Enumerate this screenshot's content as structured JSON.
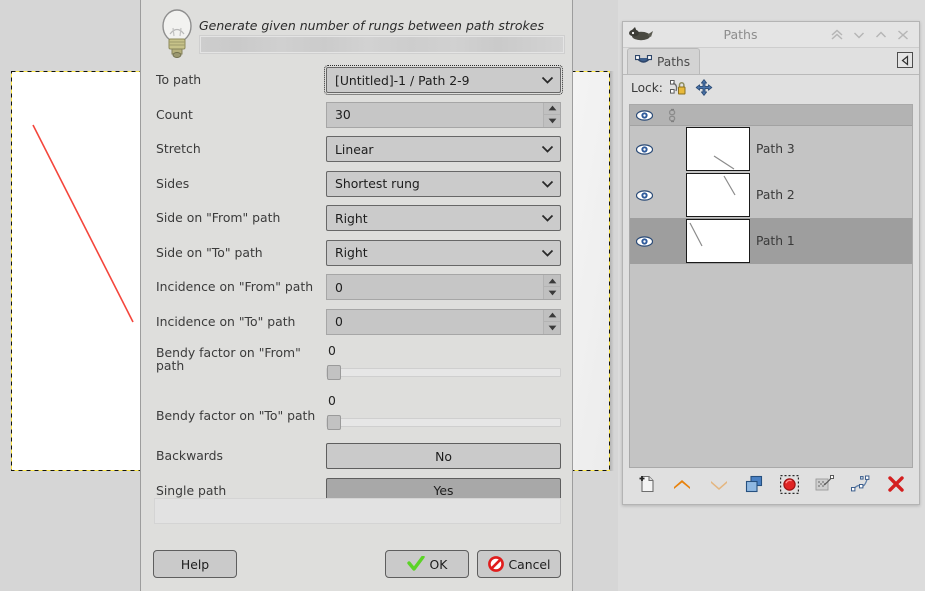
{
  "canvas": {
    "name": "image-canvas",
    "line_color": "#f4463c",
    "border_style": "yellow-black-dashed"
  },
  "dialog": {
    "description": "Generate given number of rungs between path strokes",
    "bulb_icon": "light-bulb-icon",
    "progress_label": "",
    "fields": [
      {
        "label": "To path",
        "type": "combo",
        "value": "[Untitled]-1 / Path 2-9",
        "focused": true
      },
      {
        "label": "Count",
        "type": "spin",
        "value": "30"
      },
      {
        "label": "Stretch",
        "type": "combo",
        "value": "Linear",
        "focused": false
      },
      {
        "label": "Sides",
        "type": "combo",
        "value": "Shortest rung",
        "focused": false
      },
      {
        "label": "Side on \"From\" path",
        "type": "combo",
        "value": "Right",
        "focused": false
      },
      {
        "label": "Side on \"To\" path",
        "type": "combo",
        "value": "Right",
        "focused": false
      },
      {
        "label": "Incidence on \"From\" path",
        "type": "spin",
        "value": "0"
      },
      {
        "label": "Incidence on \"To\" path",
        "type": "spin",
        "value": "0"
      },
      {
        "label": "Bendy factor on \"From\" path",
        "type": "slider",
        "value": "0"
      },
      {
        "label": "Bendy factor on \"To\" path",
        "type": "slider",
        "value": "0"
      },
      {
        "label": "Backwards",
        "type": "toggle",
        "value": "No",
        "state": "off"
      },
      {
        "label": "Single path",
        "type": "toggle",
        "value": "Yes",
        "state": "on"
      }
    ],
    "buttons": {
      "help": "Help",
      "ok": "OK",
      "cancel": "Cancel"
    }
  },
  "paths_dock": {
    "window_icon": "wilber-icon",
    "title": "Paths",
    "title_buttons": [
      {
        "name": "collapse-all-icon",
        "glyph": "double-chevron-up"
      },
      {
        "name": "chevron-down-icon",
        "glyph": "chevron-down"
      },
      {
        "name": "chevron-up-icon",
        "glyph": "chevron-up"
      },
      {
        "name": "close-icon",
        "glyph": "close"
      }
    ],
    "tab": {
      "label": "Paths",
      "icon": "paths-tab-icon"
    },
    "tab_menu_icon": "tab-menu-icon",
    "lock": {
      "label": "Lock:",
      "items": [
        {
          "name": "lock-path-icon"
        },
        {
          "name": "lock-position-icon"
        }
      ]
    },
    "columns": [
      {
        "name": "visibility-column-header",
        "icon": "eye-icon"
      },
      {
        "name": "link-column-header",
        "icon": "chain-icon"
      }
    ],
    "items": [
      {
        "name": "Path 3",
        "visible": true,
        "selected": false,
        "thumb": "line-lower-right"
      },
      {
        "name": "Path 2",
        "visible": true,
        "selected": false,
        "thumb": "line-upper-middle"
      },
      {
        "name": "Path 1",
        "visible": true,
        "selected": true,
        "thumb": "line-upper-left"
      }
    ],
    "toolbar": [
      {
        "name": "new-path-button"
      },
      {
        "name": "raise-path-button"
      },
      {
        "name": "lower-path-button"
      },
      {
        "name": "duplicate-path-button"
      },
      {
        "name": "path-to-selection-button"
      },
      {
        "name": "selection-to-path-button"
      },
      {
        "name": "stroke-path-button"
      },
      {
        "name": "delete-path-button"
      }
    ]
  }
}
